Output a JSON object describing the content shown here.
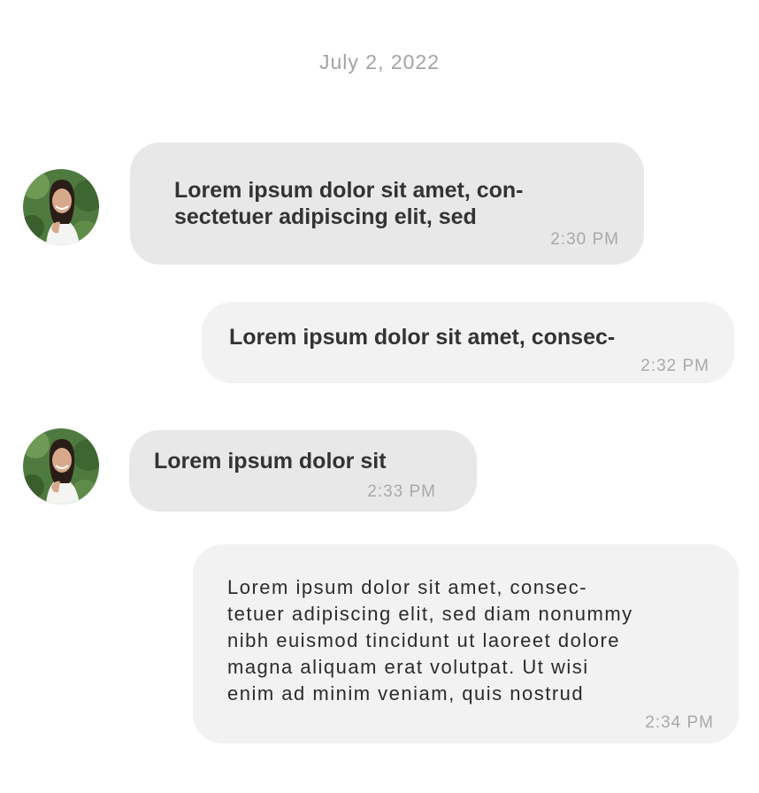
{
  "conversation": {
    "date": "July 2, 2022",
    "messages": [
      {
        "direction": "received",
        "text": "Lorem ipsum dolor sit amet, con-\nsectetuer adipiscing elit, sed",
        "time": "2:30 PM",
        "avatar_icon": "contact-avatar"
      },
      {
        "direction": "sent",
        "text": "Lorem ipsum dolor sit amet, consec-",
        "time": "2:32 PM"
      },
      {
        "direction": "received",
        "text": "Lorem ipsum dolor sit",
        "time": "2:33 PM",
        "avatar_icon": "contact-avatar"
      },
      {
        "direction": "sent",
        "text": "Lorem ipsum dolor sit amet, consec-\ntetuer adipiscing elit, sed diam nonummy\nnibh euismod tincidunt ut laoreet dolore\nmagna aliquam erat volutpat. Ut wisi\nenim ad minim veniam, quis nostrud",
        "time": "2:34 PM"
      }
    ]
  },
  "colors": {
    "received_bubble": "#e8e8e8",
    "sent_bubble": "#f2f2f2",
    "timestamp": "#a9a9a9",
    "date_divider": "#a3a3a3"
  }
}
